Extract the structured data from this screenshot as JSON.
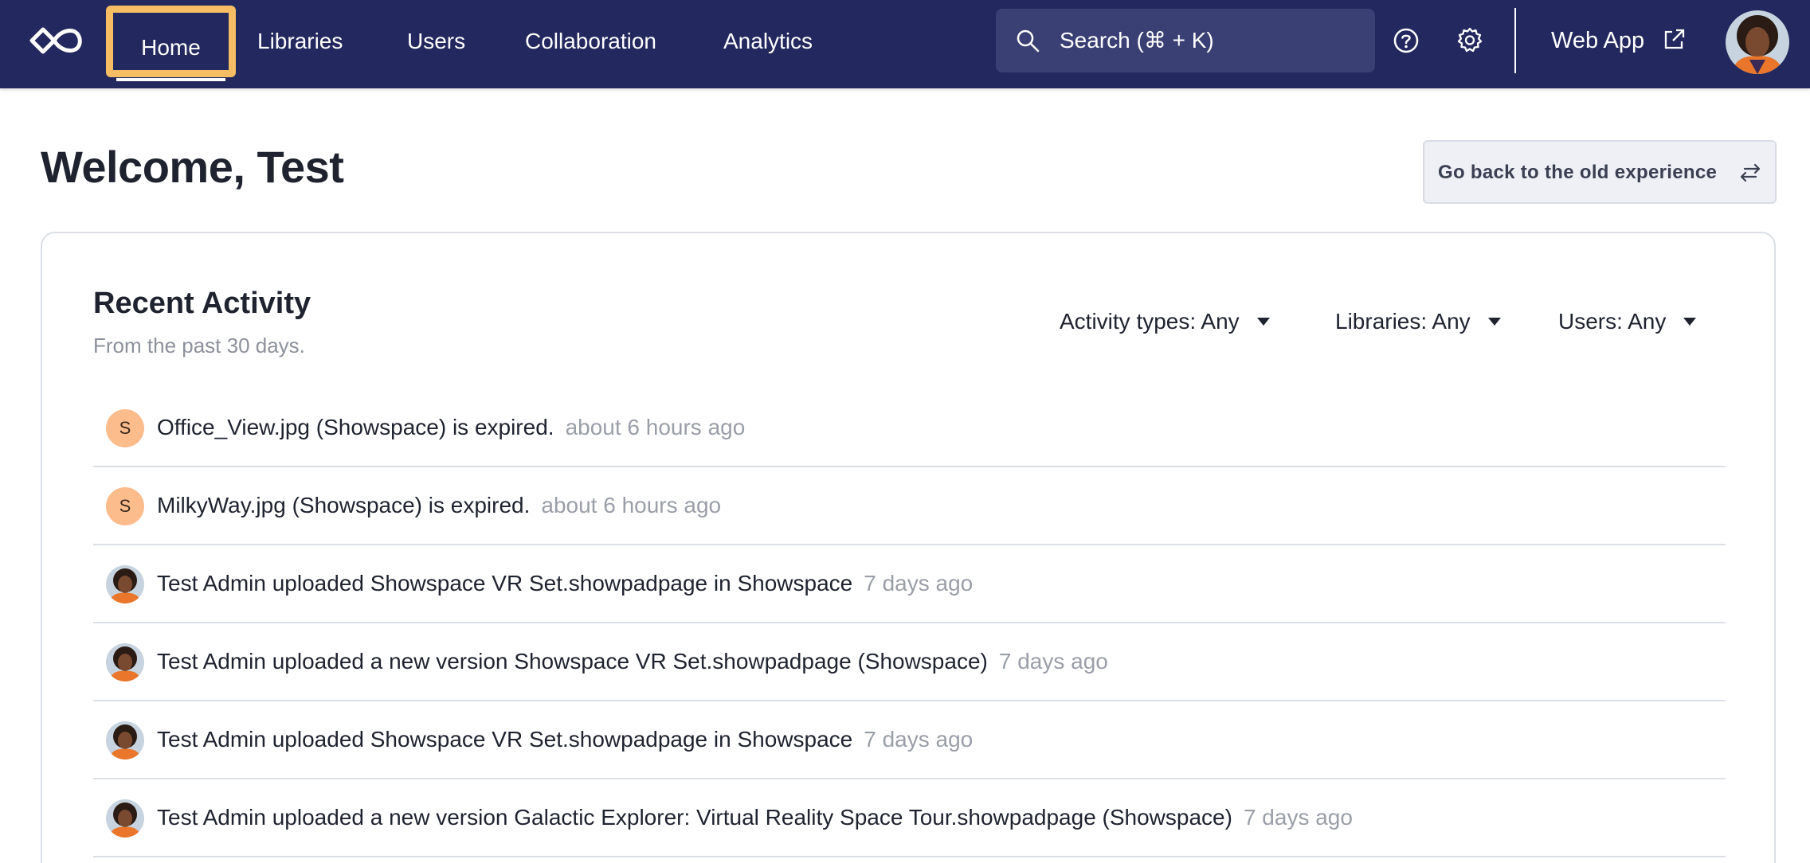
{
  "nav": {
    "items": [
      {
        "label": "Home",
        "active": true
      },
      {
        "label": "Libraries"
      },
      {
        "label": "Users"
      },
      {
        "label": "Collaboration"
      },
      {
        "label": "Analytics"
      }
    ],
    "search_placeholder": "Search (⌘ + K)",
    "web_app_label": "Web App",
    "accent_color": "#f6bd64",
    "background_color": "#23285e"
  },
  "header": {
    "welcome": "Welcome, Test",
    "old_experience_label": "Go back to the old experience"
  },
  "recent": {
    "title": "Recent Activity",
    "subtitle": "From the past 30 days.",
    "filters": {
      "types": "Activity types: Any",
      "libraries": "Libraries: Any",
      "users": "Users: Any"
    },
    "rows": [
      {
        "avatar": "S",
        "text": "Office_View.jpg (Showspace) is expired.",
        "time": "about 6 hours ago"
      },
      {
        "avatar": "S",
        "text": "MilkyWay.jpg (Showspace) is expired.",
        "time": "about 6 hours ago"
      },
      {
        "avatar": "photo",
        "text": "Test Admin uploaded Showspace VR Set.showpadpage in Showspace",
        "time": "7 days ago"
      },
      {
        "avatar": "photo",
        "text": "Test Admin uploaded a new version Showspace VR Set.showpadpage (Showspace)",
        "time": "7 days ago"
      },
      {
        "avatar": "photo",
        "text": "Test Admin uploaded Showspace VR Set.showpadpage in Showspace",
        "time": "7 days ago"
      },
      {
        "avatar": "photo",
        "text": "Test Admin uploaded a new version Galactic Explorer: Virtual Reality Space Tour.showpadpage (Showspace)",
        "time": "7 days ago"
      }
    ]
  }
}
